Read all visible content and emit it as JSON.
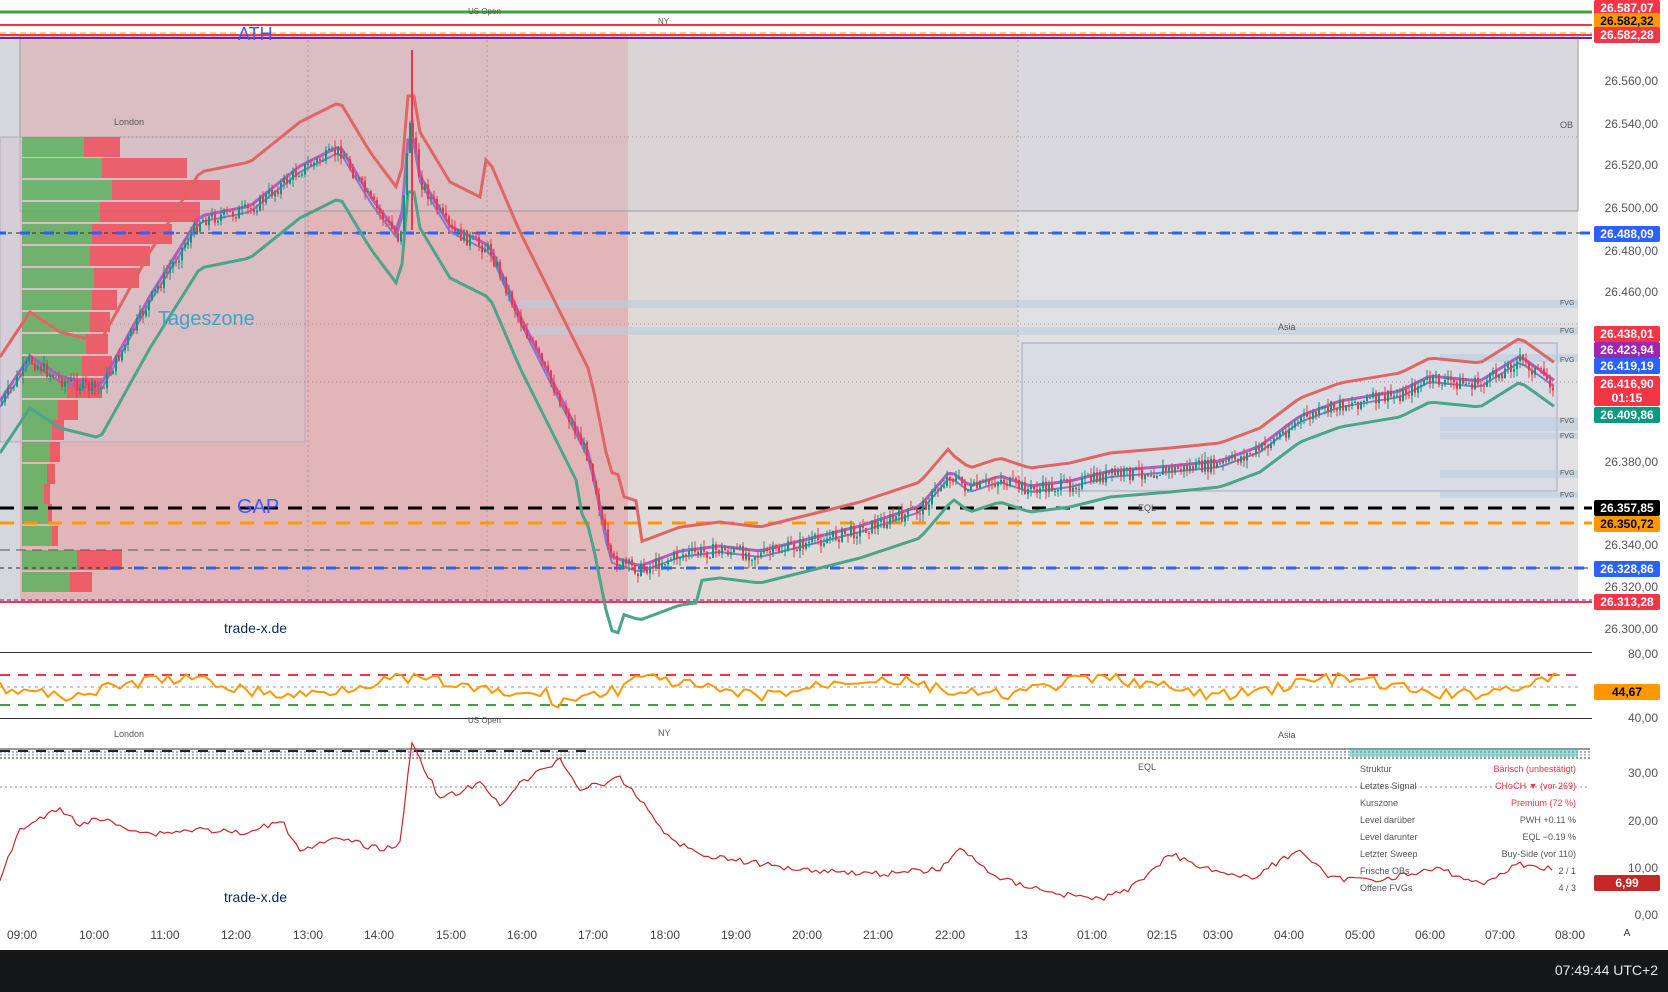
{
  "colors": {
    "accent_blue": "#2962ff",
    "bull": "#089981",
    "bear": "#f23645",
    "rsi": "#ff9800",
    "ema_fast": "#7e7ec8",
    "ema_slow": "#b05fc0",
    "band_upper": "#e06666",
    "band_lower": "#4aa58a"
  },
  "labels": {
    "ath": "ATH",
    "gap": "GAP",
    "tageszone": "Tageszone",
    "watermark": "trade-x.de",
    "watermark2": "trade-x.de",
    "london": "London",
    "london2": "London",
    "us_open": "US Open",
    "us_open2": "US Open",
    "ny": "NY",
    "ny2": "NY",
    "asia": "Asia",
    "asia2": "Asia",
    "ob": "OB",
    "eql": "EQL",
    "eql2": "EQL",
    "fvg": "FVG"
  },
  "price_axis": {
    "ticks": [
      "26.560,00",
      "26.540,00",
      "26.520,00",
      "26.500,00",
      "26.480,00",
      "26.460,00",
      "26.380,00",
      "26.340,00",
      "26.320,00",
      "26.300,00"
    ],
    "badges": [
      {
        "text": "26.587,07",
        "bg": "#f23645",
        "fg": "#ffffff"
      },
      {
        "text": "26.582,32",
        "bg": "#ff9800",
        "fg": "#000000"
      },
      {
        "text": "26.582,28",
        "bg": "#f23645",
        "fg": "#ffffff"
      },
      {
        "text": "26.488,09",
        "bg": "#2962ff",
        "fg": "#ffffff"
      },
      {
        "text": "26.438,01",
        "bg": "#f23645",
        "fg": "#ffffff"
      },
      {
        "text": "26.423,94",
        "bg": "#9c27b0",
        "fg": "#ffffff"
      },
      {
        "text": "26.419,19",
        "bg": "#2962ff",
        "fg": "#ffffff"
      },
      {
        "text": "26.416,90",
        "bg": "#f23645",
        "fg": "#ffffff"
      },
      {
        "text": "01:15",
        "bg": "#f23645",
        "fg": "#ffffff"
      },
      {
        "text": "26.409,86",
        "bg": "#089981",
        "fg": "#ffffff"
      },
      {
        "text": "26.357,85",
        "bg": "#000000",
        "fg": "#ffffff"
      },
      {
        "text": "26.350,72",
        "bg": "#ff9800",
        "fg": "#000000"
      },
      {
        "text": "26.328,86",
        "bg": "#2962ff",
        "fg": "#ffffff"
      },
      {
        "text": "26.313,28",
        "bg": "#f23645",
        "fg": "#ffffff"
      }
    ]
  },
  "rsi_pane": {
    "ticks": [
      "80,00",
      "40,00"
    ],
    "value": "44,67"
  },
  "indicator_pane": {
    "ticks": [
      "30,00",
      "20,00",
      "10,00",
      "0,00"
    ],
    "value": "6,99"
  },
  "info_table": {
    "rows": [
      {
        "k": "Struktur",
        "v": "Bärisch (unbestätigt)",
        "color": "#f23645"
      },
      {
        "k": "Letztes Signal",
        "v": "CHoCH ▼ (vor 269)",
        "color": "#f23645"
      },
      {
        "k": "Kurszone",
        "v": "Premium (72 %)",
        "color": "#f23645"
      },
      {
        "k": "Level darüber",
        "v": "PWH +0.11 %",
        "color": "#555555"
      },
      {
        "k": "Level darunter",
        "v": "EQL −0.19 %",
        "color": "#555555"
      },
      {
        "k": "Letzter Sweep",
        "v": "Buy-Side (vor 110)",
        "color": "#555555"
      },
      {
        "k": "Frische OBs",
        "v": "2 / 1",
        "color": "#555555"
      },
      {
        "k": "Offene FVGs",
        "v": "4 / 3",
        "color": "#555555"
      }
    ]
  },
  "time_axis": [
    "09:00",
    "10:00",
    "11:00",
    "12:00",
    "13:00",
    "14:00",
    "15:00",
    "16:00",
    "17:00",
    "18:00",
    "19:00",
    "20:00",
    "21:00",
    "22:00",
    "13",
    "01:00",
    "02:15",
    "03:00",
    "04:00",
    "05:00",
    "06:00",
    "07:00",
    "08:00"
  ],
  "axis_mode": "A",
  "status": {
    "clock": "07:49:44 UTC+2"
  }
}
